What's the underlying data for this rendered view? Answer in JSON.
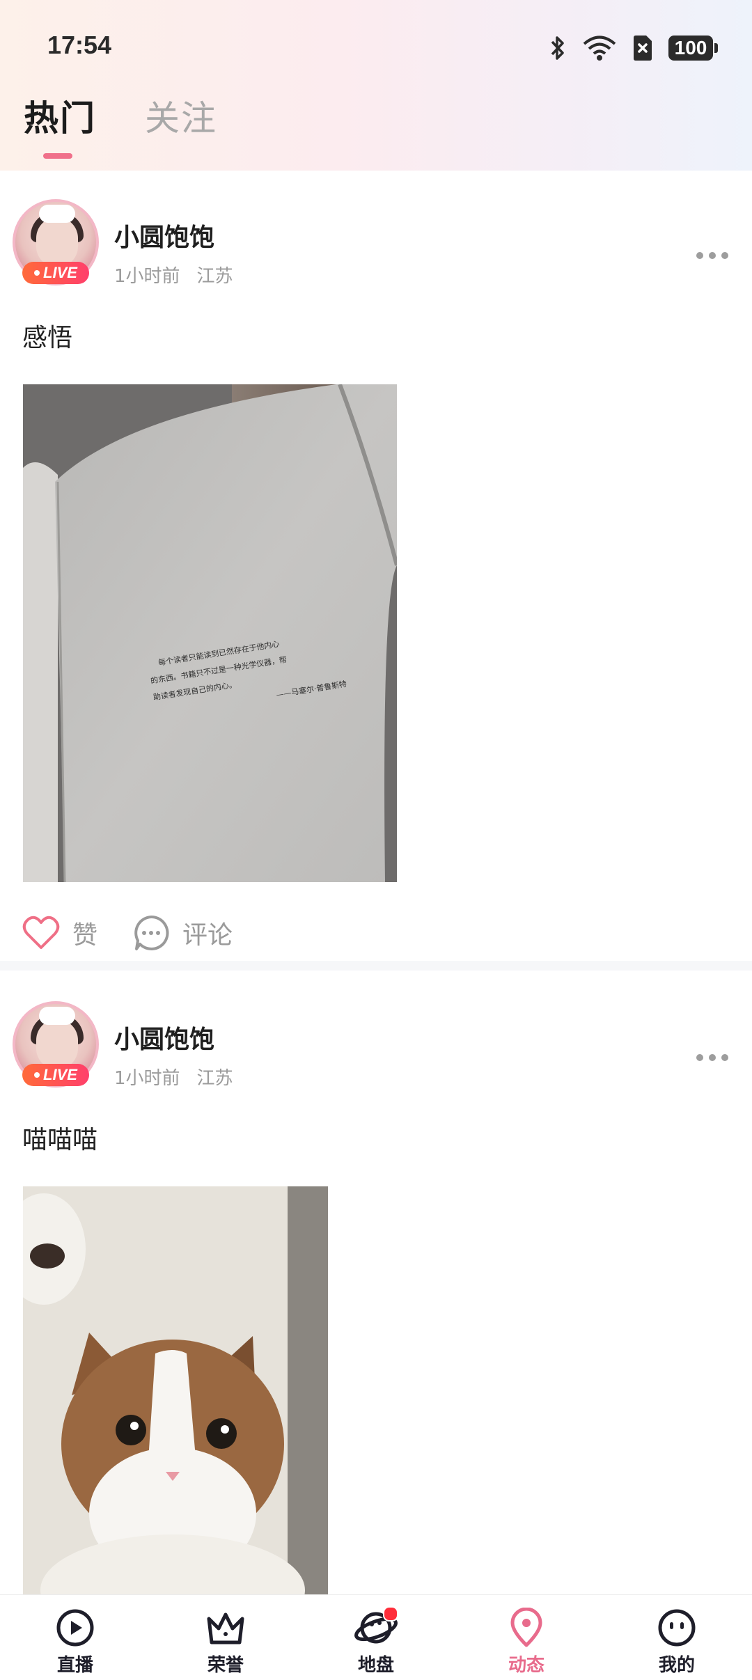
{
  "status_bar": {
    "time": "17:54",
    "battery": "100"
  },
  "tabs": [
    {
      "label": "热门",
      "active": true
    },
    {
      "label": "关注",
      "active": false
    }
  ],
  "posts": [
    {
      "username": "小圆饱饱",
      "badge": "LIVE",
      "time": "1小时前",
      "location": "江苏",
      "text": "感悟",
      "image": "book-page-photo",
      "book_quote": [
        "每个读者只能读到已然存在于他内心",
        "的东西。书籍只不过是一种光学仪器，帮",
        "助读者发现自己的内心。",
        "——马塞尔·普鲁斯特"
      ],
      "like_label": "赞",
      "comment_label": "评论"
    },
    {
      "username": "小圆饱饱",
      "badge": "LIVE",
      "time": "1小时前",
      "location": "江苏",
      "text": "喵喵喵",
      "image": "cat-photo"
    }
  ],
  "bottom_nav": [
    {
      "label": "直播",
      "icon": "play-icon",
      "active": false
    },
    {
      "label": "荣誉",
      "icon": "crown-icon",
      "active": false
    },
    {
      "label": "地盘",
      "icon": "planet-icon",
      "active": false,
      "badge_dot": true
    },
    {
      "label": "动态",
      "icon": "location-pin-icon",
      "active": true
    },
    {
      "label": "我的",
      "icon": "face-icon",
      "active": false
    }
  ],
  "colors": {
    "accent": "#e86b8c",
    "live_badge": "#ff4f55"
  }
}
